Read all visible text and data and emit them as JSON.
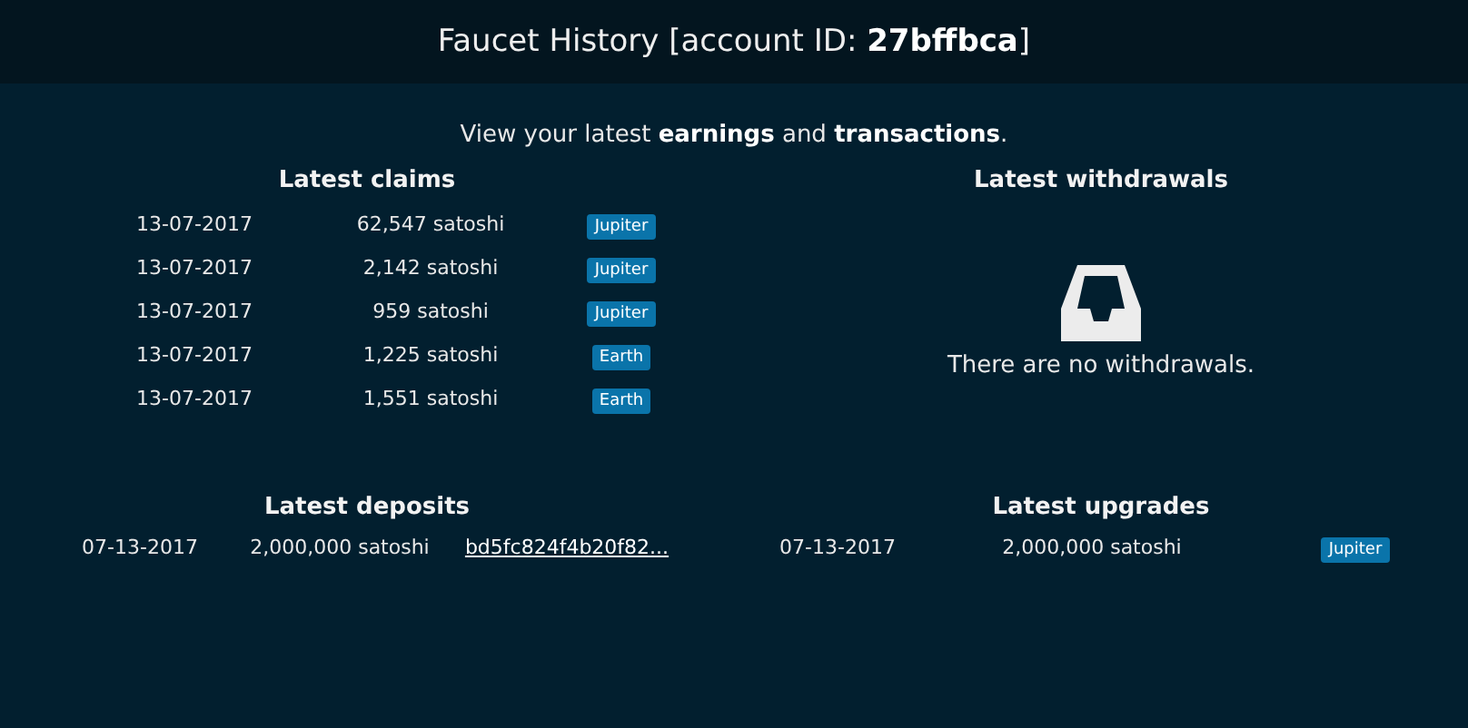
{
  "header": {
    "title": "Faucet History [account ID: **27bffbca**]"
  },
  "intro": "View your latest **earnings** and **transactions**.",
  "latest_claims": {
    "title": "Latest claims",
    "rows": [
      {
        "date": "13-07-2017",
        "amount": "62,547 satoshi",
        "tag": "Jupiter"
      },
      {
        "date": "13-07-2017",
        "amount": "2,142 satoshi",
        "tag": "Jupiter"
      },
      {
        "date": "13-07-2017",
        "amount": "959 satoshi",
        "tag": "Jupiter"
      },
      {
        "date": "13-07-2017",
        "amount": "1,225 satoshi",
        "tag": "Earth"
      },
      {
        "date": "13-07-2017",
        "amount": "1,551 satoshi",
        "tag": "Earth"
      }
    ]
  },
  "latest_withdrawals": {
    "title": "Latest withdrawals",
    "empty_message": "There are no withdrawals."
  },
  "latest_deposits": {
    "title": "Latest deposits",
    "rows": [
      {
        "date": "07-13-2017",
        "amount": "2,000,000 satoshi",
        "transaction": "bd5fc824f4b20f82..."
      }
    ]
  },
  "latest_upgrades": {
    "title": "Latest upgrades",
    "rows": [
      {
        "date": "07-13-2017",
        "amount": "2,000,000 satoshi",
        "tag": "Jupiter"
      }
    ]
  }
}
